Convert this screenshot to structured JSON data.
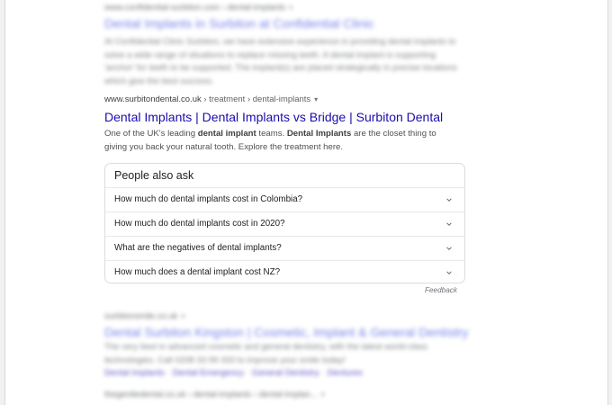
{
  "results_top": {
    "cite": "www.confidential-surbiton.com › dental-implants",
    "title": "Dental Implants in Surbiton at Confidential Clinic",
    "snippet": "At Confidential Clinic Surbiton, we have extensive experience in providing dental implants to solve a wide range of situations to replace missing teeth. A dental implant is supporting 'anchor' for teeth to be supported. The implant(s) are placed strategically in precise locations which give the best success."
  },
  "result_main": {
    "cite_domain": "www.surbitondental.co.uk",
    "cite_path": " › treatment › dental-implants",
    "title": "Dental Implants | Dental Implants vs Bridge | Surbiton Dental",
    "snippet_1": "One of the UK's leading ",
    "snippet_bold_1": "dental implant",
    "snippet_2": " teams. ",
    "snippet_bold_2": "Dental Implants",
    "snippet_3": " are the closet thing to giving you back your natural tooth. Explore the treatment here."
  },
  "people_also_ask": {
    "heading": "People also ask",
    "questions": [
      "How much do dental implants cost in Colombia?",
      "How much do dental implants cost in 2020?",
      "What are the negatives of dental implants?",
      "How much does a dental implant cost NZ?"
    ],
    "feedback": "Feedback"
  },
  "results_bottom": [
    {
      "cite": "surbitonsmile.co.uk",
      "title": "Dental Surbiton Kingston | Cosmetic, Implant & General Dentistry",
      "snippet": "The very best in advanced cosmetic and general dentistry, with the latest world-class technologies. Call 0208 33 99 333 to improve your smile today!",
      "sitelinks": [
        "Dental Implants",
        "Dental Emergency",
        "General Dentistry",
        "Dentures"
      ]
    },
    {
      "cite": "thegentledental.co.uk › dental-implants › dental-implan...",
      "title": "",
      "snippet": ""
    }
  ],
  "colors": {
    "link": "#1a0dab",
    "cite": "#3c4043",
    "snippet": "#4d5156",
    "border": "#dadce0"
  },
  "icons": {
    "paa_chevron": "chevron-down-icon",
    "cite_menu": "caret-down-icon"
  }
}
